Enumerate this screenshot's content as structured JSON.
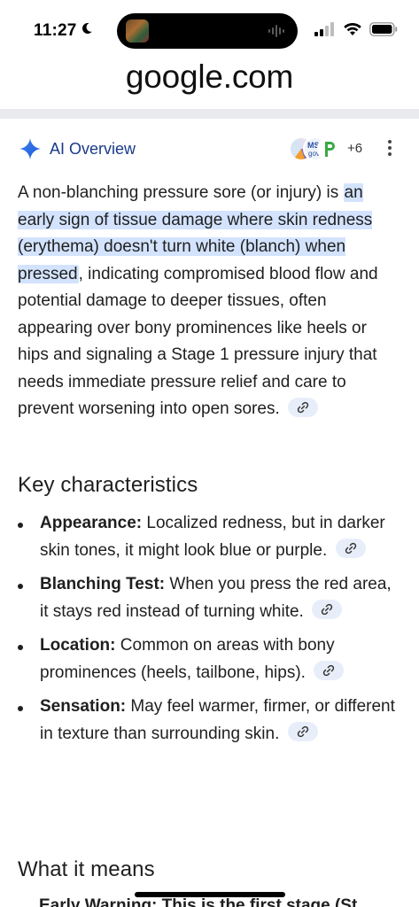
{
  "status_bar": {
    "time": "11:27"
  },
  "browser": {
    "url": "google.com"
  },
  "ai_overview": {
    "title": "AI Overview",
    "source_count": "+6",
    "intro_before": "A non-blanching pressure sore (or injury) is ",
    "intro_highlight": "an early sign of tissue damage where skin redness (erythema) doesn't turn white (blanch) when pressed",
    "intro_after": ", indicating compromised blood flow and potential damage to deeper tissues, often appearing over bony prominences like heels or hips and signaling a Stage 1 pressure injury that needs immediate pressure relief and care to prevent worsening into open sores."
  },
  "key_characteristics": {
    "heading": "Key characteristics",
    "items": [
      {
        "term": "Appearance:",
        "text": " Localized redness, but in darker skin tones, it might look blue or purple."
      },
      {
        "term": "Blanching Test:",
        "text": " When you press the red area, it stays red instead of turning white."
      },
      {
        "term": "Location:",
        "text": " Common on areas with bony prominences (heels, tailbone, hips)."
      },
      {
        "term": "Sensation:",
        "text": " May feel warmer, firmer, or different in texture than surrounding skin."
      }
    ]
  },
  "what_it_means": {
    "heading": "What it means",
    "peek_text": "Early Warning: This is the first stage (St"
  },
  "colors": {
    "highlight": "#d3e3fd",
    "ai_title": "#1a3a8a",
    "sparkle": "#1a73e8"
  },
  "icons": [
    "moon-icon",
    "signal-icon",
    "wifi-icon",
    "battery-icon",
    "ai-sparkle-icon",
    "kebab-menu-icon",
    "link-icon"
  ]
}
